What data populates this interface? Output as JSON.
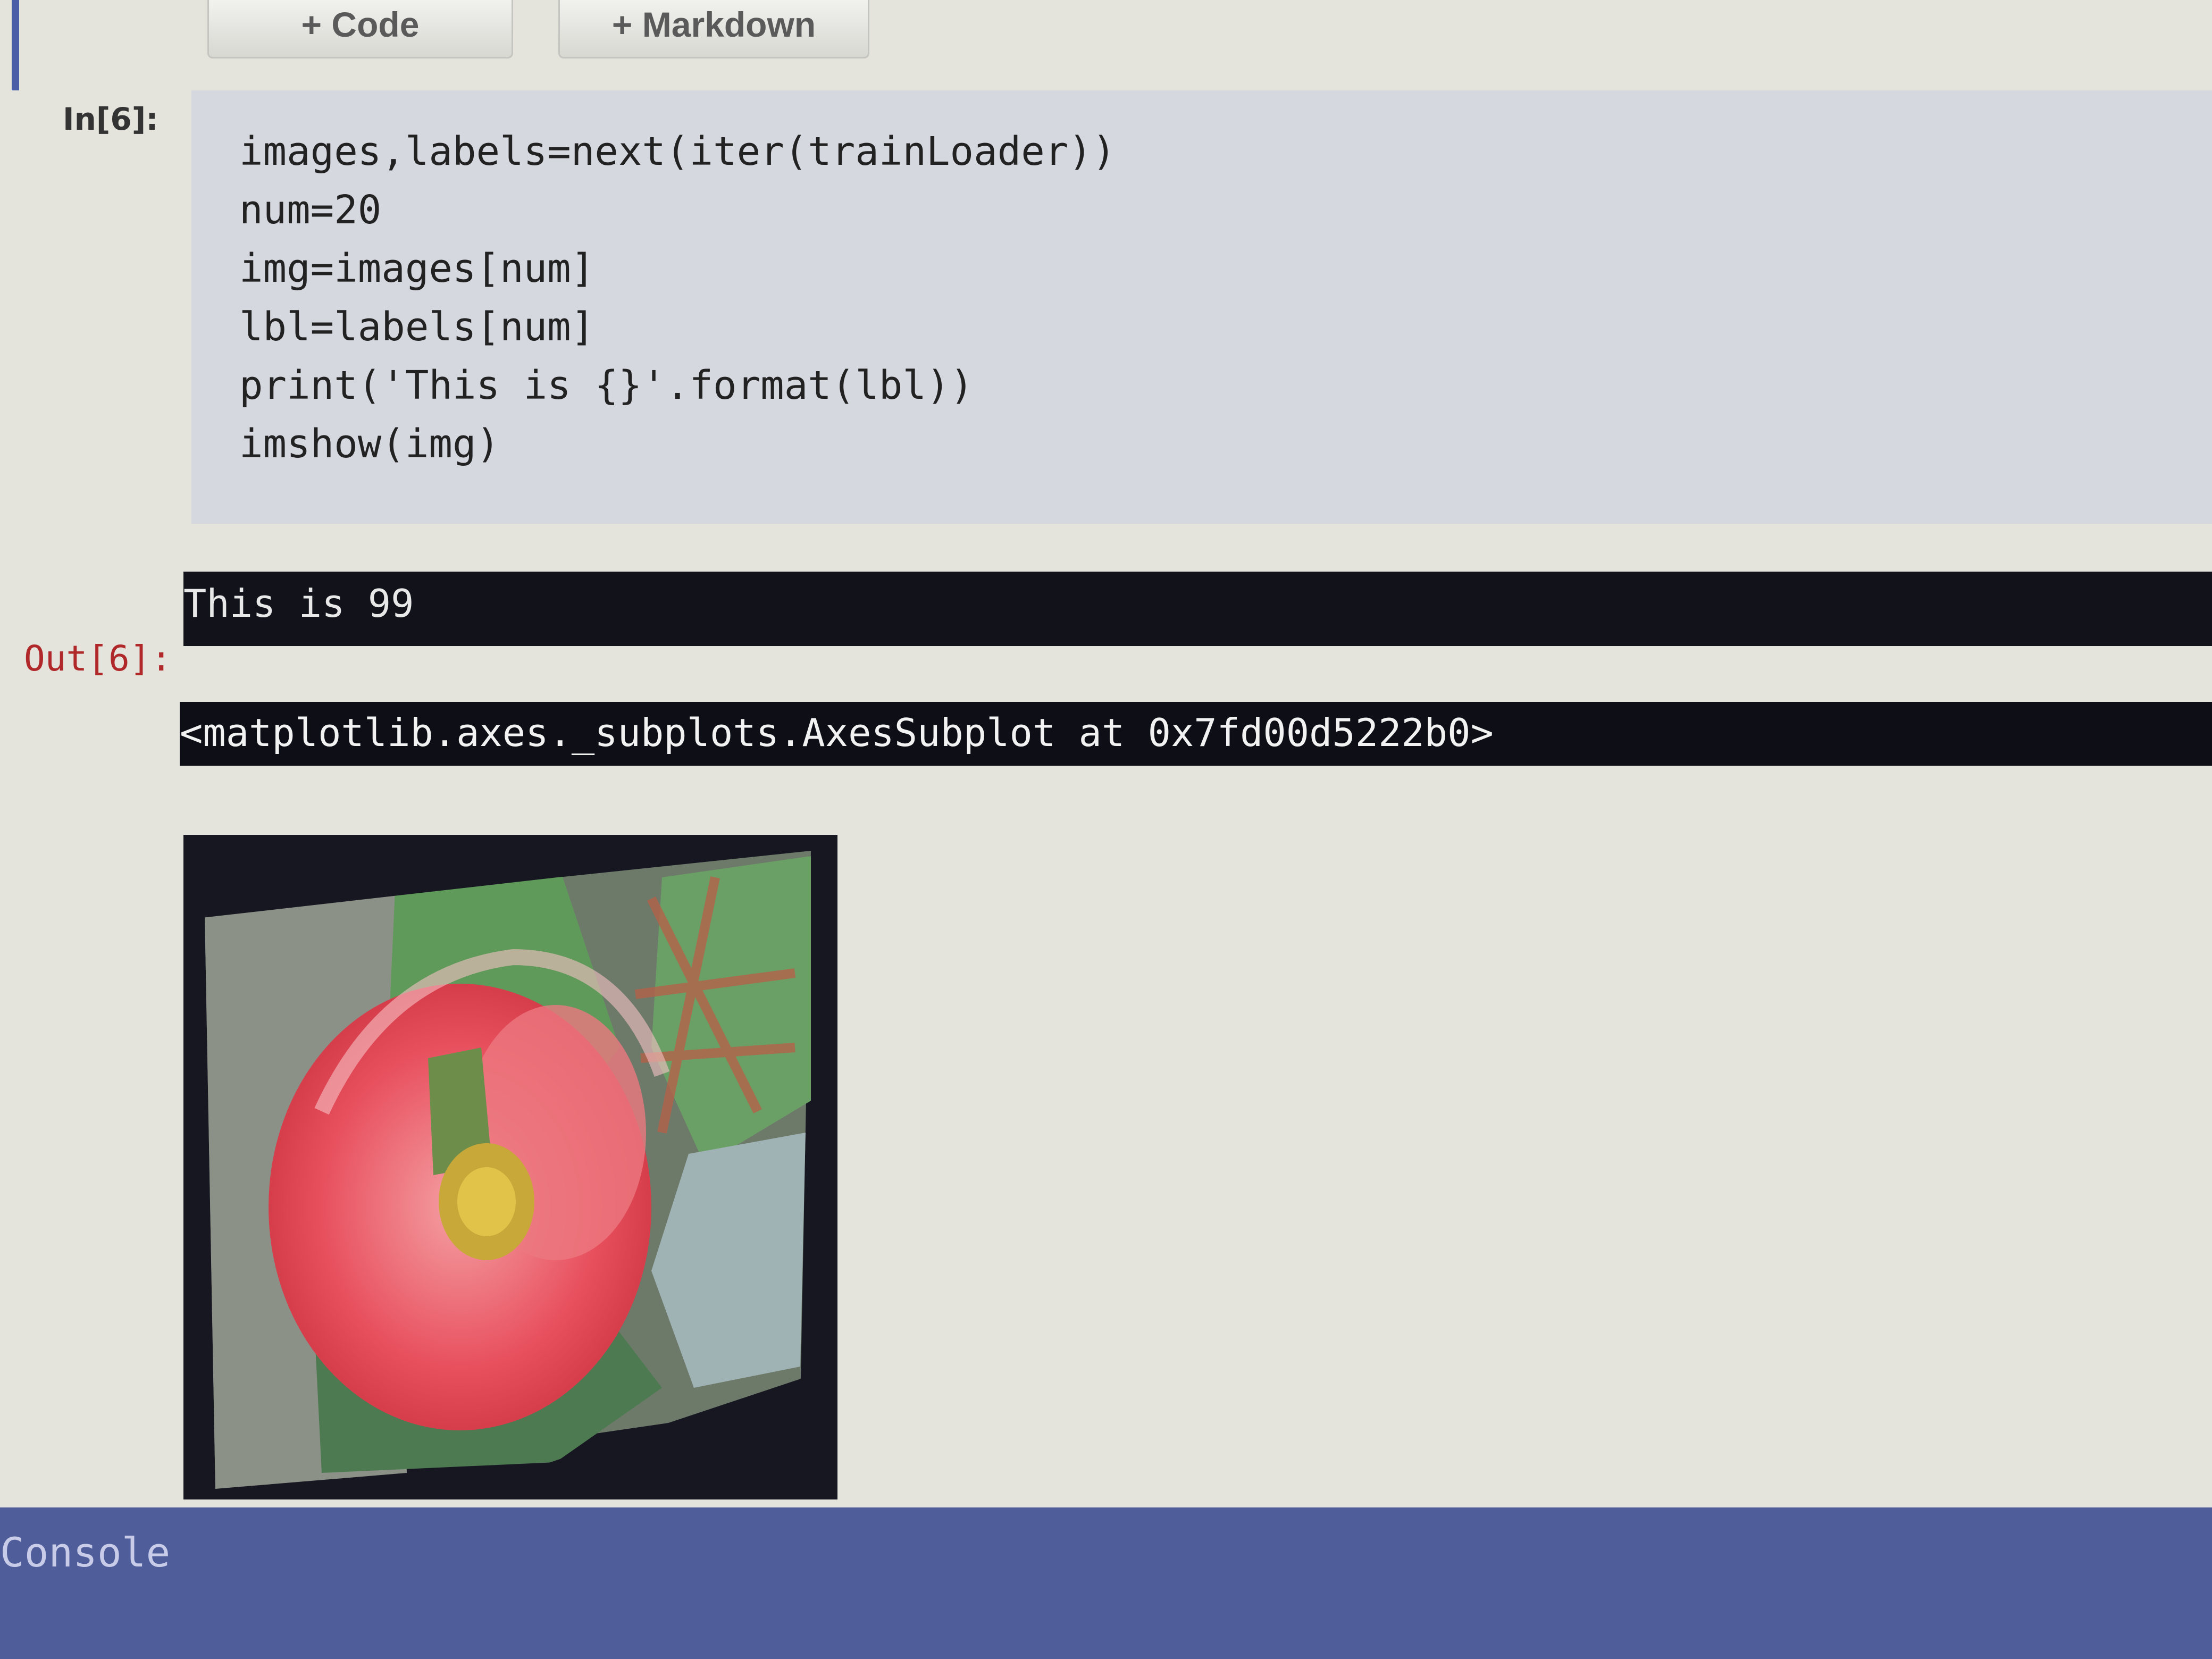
{
  "toolbar": {
    "add_code_label": "+ Code",
    "add_markdown_label": "+ Markdown"
  },
  "cell": {
    "in_prompt": "In[6]:",
    "out_prompt": "Out[6]:",
    "code_lines": [
      "images,labels=next(iter(trainLoader))",
      "num=20",
      "img=images[num]",
      "lbl=labels[num]",
      "print('This is {}'.format(lbl))",
      "imshow(img)"
    ],
    "stdout": "This is 99",
    "result": "<matplotlib.axes._subplots.AxesSubplot at 0x7fd00d5222b0>"
  },
  "output_image": {
    "subject": "flower-image"
  },
  "console": {
    "label": "Console"
  },
  "colors": {
    "page_bg": "#e4e4dc",
    "code_bg": "#d6d8e0",
    "output_bg": "#11121a",
    "out_prompt": "#b0282a",
    "console_bar": "#4f5e9a"
  }
}
